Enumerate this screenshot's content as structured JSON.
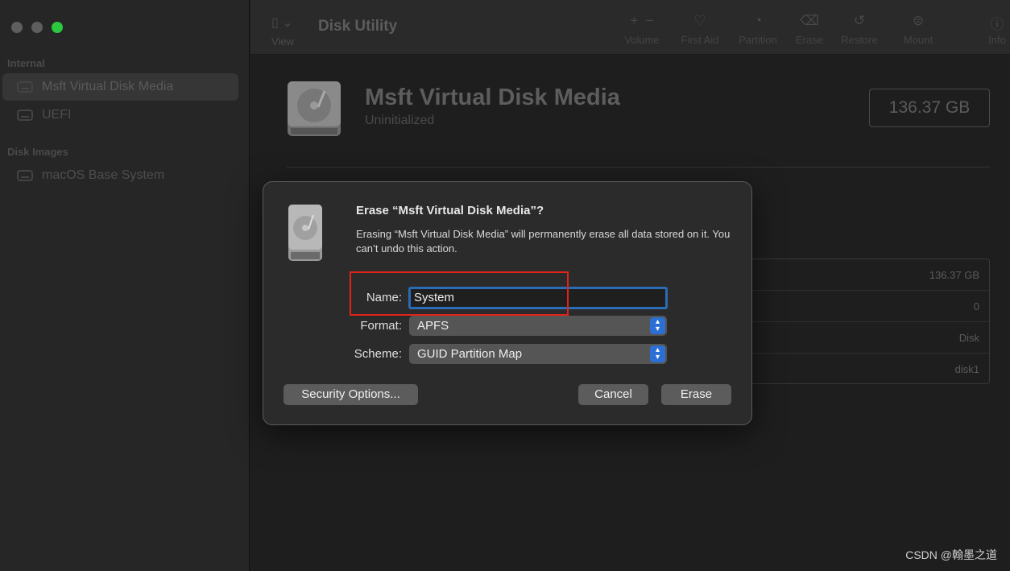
{
  "sidebar": {
    "section_internal": "Internal",
    "items_internal": [
      "Msft Virtual Disk Media",
      "UEFI"
    ],
    "section_images": "Disk Images",
    "items_images": [
      "macOS Base System"
    ]
  },
  "toolbar": {
    "view_label": "View",
    "title": "Disk Utility",
    "volume_label": "Volume",
    "first_aid_label": "First Aid",
    "partition_label": "Partition",
    "erase_label": "Erase",
    "restore_label": "Restore",
    "mount_label": "Mount",
    "info_label": "Info"
  },
  "disk": {
    "name": "Msft Virtual Disk Media",
    "status": "Uninitialized",
    "capacity": "136.37 GB",
    "info_values": [
      "136.37 GB",
      "0",
      "Disk",
      "disk1"
    ]
  },
  "dialog": {
    "title": "Erase “Msft Virtual Disk Media”?",
    "message": "Erasing “Msft Virtual Disk Media” will permanently erase all data stored on it. You can’t undo this action.",
    "name_label": "Name:",
    "name_value": "System",
    "format_label": "Format:",
    "format_value": "APFS",
    "scheme_label": "Scheme:",
    "scheme_value": "GUID Partition Map",
    "security_button": "Security Options...",
    "cancel_button": "Cancel",
    "erase_button": "Erase"
  },
  "watermark": "CSDN @翰墨之道",
  "colors": {
    "accent": "#2c6fd4",
    "highlight_box": "#e2231a",
    "traffic_green": "#2bc840"
  }
}
